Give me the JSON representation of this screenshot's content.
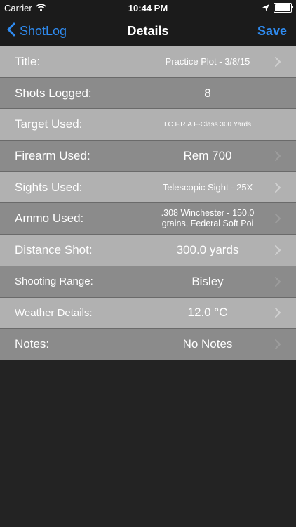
{
  "status_bar": {
    "carrier": "Carrier",
    "time": "10:44 PM",
    "icons": [
      "wifi-icon",
      "location-arrow-icon",
      "battery-icon"
    ],
    "battery_level": 1.0
  },
  "nav": {
    "back_label": "ShotLog",
    "title": "Details",
    "save_label": "Save",
    "accent_color": "#2f8bf0"
  },
  "rows": [
    {
      "label": "Title:",
      "value": "Practice Plot - 3/8/15"
    },
    {
      "label": "Shots Logged:",
      "value": "8"
    },
    {
      "label": "Target Used:",
      "value": "I.C.F.R.A F-Class 300 Yards"
    },
    {
      "label": "Firearm Used:",
      "value": "Rem 700"
    },
    {
      "label": "Sights Used:",
      "value": "Telescopic Sight - 25X"
    },
    {
      "label": "Ammo Used:",
      "value_line1": ".308 Winchester - 150.0",
      "value_line2": "grains, Federal Soft Poi"
    },
    {
      "label": "Distance Shot:",
      "value": "300.0 yards"
    },
    {
      "label": "Shooting Range:",
      "value": "Bisley"
    },
    {
      "label": "Weather Details:",
      "value": "12.0 °C"
    },
    {
      "label": "Notes:",
      "value": "No Notes"
    }
  ],
  "colors": {
    "row_light": "#b1b1b1",
    "row_dark": "#8b8b8b",
    "background": "#232323",
    "bar": "#1b1b1b"
  }
}
